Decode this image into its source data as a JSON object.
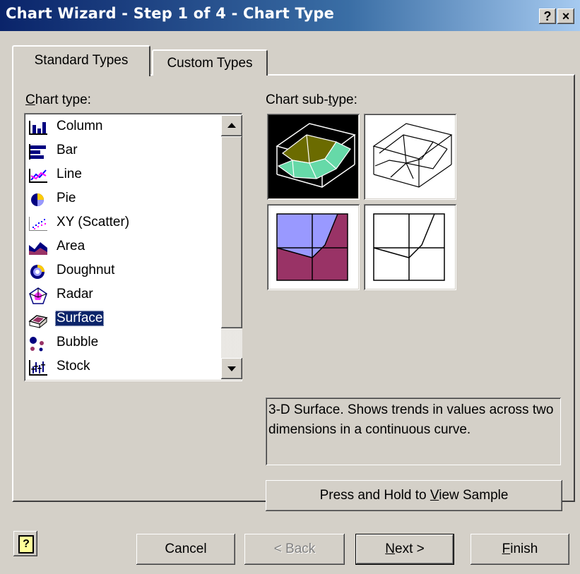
{
  "window": {
    "title": "Chart Wizard - Step 1 of 4 - Chart Type",
    "help_btn": "?",
    "close_btn": "×"
  },
  "tabs": [
    {
      "label": "Standard Types",
      "selected": true
    },
    {
      "label": "Custom Types",
      "selected": false
    }
  ],
  "chart_type_label": {
    "pre": "",
    "key": "C",
    "post": "hart type:"
  },
  "chart_subtype_label": {
    "pre": "Chart sub-",
    "key": "t",
    "post": "ype:"
  },
  "chart_types": [
    {
      "label": "Column",
      "icon": "column-chart-icon"
    },
    {
      "label": "Bar",
      "icon": "bar-chart-icon"
    },
    {
      "label": "Line",
      "icon": "line-chart-icon"
    },
    {
      "label": "Pie",
      "icon": "pie-chart-icon"
    },
    {
      "label": "XY (Scatter)",
      "icon": "scatter-chart-icon"
    },
    {
      "label": "Area",
      "icon": "area-chart-icon"
    },
    {
      "label": "Doughnut",
      "icon": "doughnut-chart-icon"
    },
    {
      "label": "Radar",
      "icon": "radar-chart-icon"
    },
    {
      "label": "Surface",
      "icon": "surface-chart-icon",
      "selected": true
    },
    {
      "label": "Bubble",
      "icon": "bubble-chart-icon"
    },
    {
      "label": "Stock",
      "icon": "stock-chart-icon"
    }
  ],
  "subtypes": [
    "3d-surface",
    "3d-surface-wireframe",
    "contour",
    "contour-wireframe"
  ],
  "description": "3-D Surface. Shows trends in values across two dimensions in a continuous curve.",
  "sample_button": {
    "pre": "Press and Hold to ",
    "key": "V",
    "post": "iew Sample"
  },
  "buttons": {
    "help_icon": "?",
    "cancel": "Cancel",
    "back": "< Back",
    "next_key": "N",
    "next_post": "ext >",
    "finish_key": "F",
    "finish_post": "inish"
  },
  "colors": {
    "selection": "#0a246a",
    "face": "#d4d0c8",
    "surface_olive": "#6b6b00",
    "surface_mint": "#66d9a8",
    "contour_lavender": "#9999ff",
    "contour_maroon": "#993366"
  }
}
